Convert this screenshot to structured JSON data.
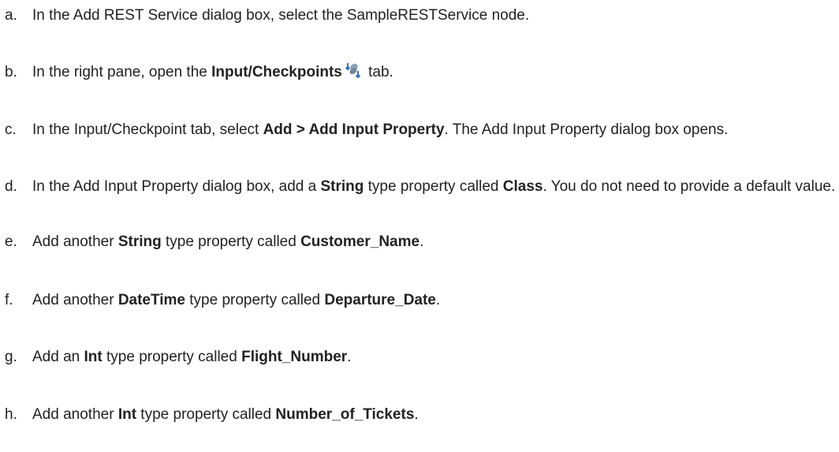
{
  "steps": [
    {
      "marker": "a.",
      "parts": [
        {
          "t": "In the Add REST Service dialog box, select the SampleRESTService node.",
          "b": false
        }
      ]
    },
    {
      "marker": "b.",
      "parts": [
        {
          "t": "In the right pane, open the ",
          "b": false
        },
        {
          "t": "Input/Checkpoints",
          "b": true
        },
        {
          "icon": "input-checkpoints-icon"
        },
        {
          "t": " tab.",
          "b": false
        }
      ]
    },
    {
      "marker": "c.",
      "parts": [
        {
          "t": "In the Input/Checkpoint tab, select ",
          "b": false
        },
        {
          "t": "Add > Add Input Property",
          "b": true
        },
        {
          "t": ". The Add Input Property dialog box opens.",
          "b": false
        }
      ]
    },
    {
      "marker": "d.",
      "parts": [
        {
          "t": "In the Add Input Property dialog box, add a ",
          "b": false
        },
        {
          "t": "String",
          "b": true
        },
        {
          "t": " type property called ",
          "b": false
        },
        {
          "t": "Class",
          "b": true
        },
        {
          "t": ". You do not need to provide a default value.",
          "b": false
        }
      ]
    },
    {
      "marker": "e.",
      "parts": [
        {
          "t": "Add another ",
          "b": false
        },
        {
          "t": "String",
          "b": true
        },
        {
          "t": " type property called ",
          "b": false
        },
        {
          "t": "Customer_Name",
          "b": true
        },
        {
          "t": ".",
          "b": false
        }
      ]
    },
    {
      "marker": "f.",
      "parts": [
        {
          "t": "Add another ",
          "b": false
        },
        {
          "t": "DateTime",
          "b": true
        },
        {
          "t": " type property called ",
          "b": false
        },
        {
          "t": "Departure_Date",
          "b": true
        },
        {
          "t": ".",
          "b": false
        }
      ]
    },
    {
      "marker": "g.",
      "parts": [
        {
          "t": "Add an ",
          "b": false
        },
        {
          "t": "Int",
          "b": true
        },
        {
          "t": " type property called ",
          "b": false
        },
        {
          "t": "Flight_Number",
          "b": true
        },
        {
          "t": ".",
          "b": false
        }
      ]
    },
    {
      "marker": "h.",
      "parts": [
        {
          "t": "Add another ",
          "b": false
        },
        {
          "t": "Int",
          "b": true
        },
        {
          "t": " type property called ",
          "b": false
        },
        {
          "t": "Number_of_Tickets",
          "b": true
        },
        {
          "t": ".",
          "b": false
        }
      ]
    }
  ]
}
